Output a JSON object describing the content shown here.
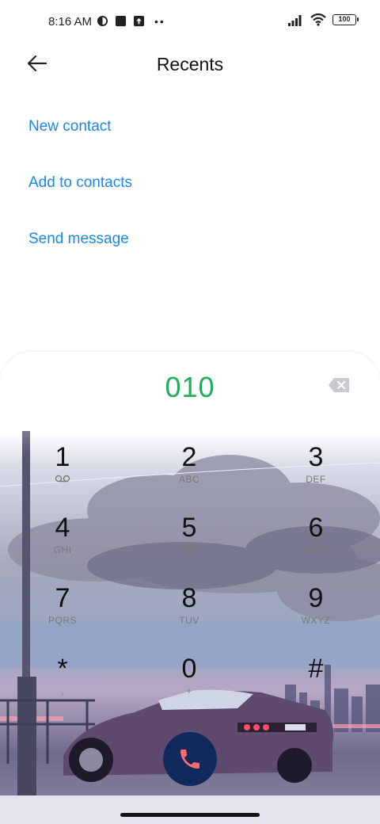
{
  "status_bar": {
    "time": "8:16 AM",
    "battery": "100"
  },
  "header": {
    "title": "Recents"
  },
  "actions": [
    {
      "label": "New contact"
    },
    {
      "label": "Add to contacts"
    },
    {
      "label": "Send message"
    }
  ],
  "dialer": {
    "number": "010",
    "keys": [
      {
        "digit": "1",
        "letters": ""
      },
      {
        "digit": "2",
        "letters": "ABC"
      },
      {
        "digit": "3",
        "letters": "DEF"
      },
      {
        "digit": "4",
        "letters": "GHI"
      },
      {
        "digit": "5",
        "letters": "JKL"
      },
      {
        "digit": "6",
        "letters": "MNO"
      },
      {
        "digit": "7",
        "letters": "PQRS"
      },
      {
        "digit": "8",
        "letters": "TUV"
      },
      {
        "digit": "9",
        "letters": "WXYZ"
      },
      {
        "digit": "*",
        "letters": ","
      },
      {
        "digit": "0",
        "letters": "+"
      },
      {
        "digit": "#",
        "letters": ""
      }
    ]
  },
  "colors": {
    "accent": "#1a88e6",
    "number": "#1fae5a",
    "call_button": "#102a5c",
    "call_icon": "#ff6b6b"
  },
  "icons": {
    "back": "arrow-left-icon",
    "backspace": "backspace-icon",
    "voicemail": "voicemail-icon",
    "call": "phone-icon"
  }
}
